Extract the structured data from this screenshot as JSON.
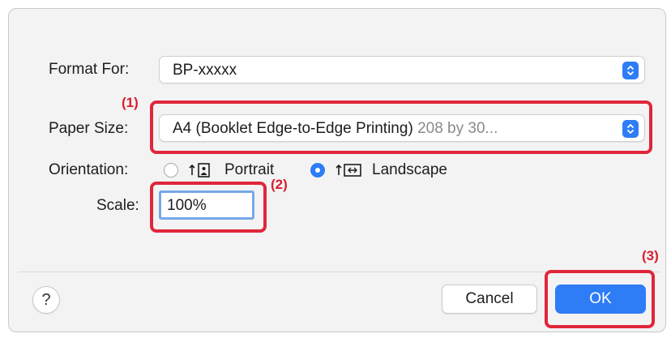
{
  "format_for": {
    "label": "Format For:",
    "value": "BP-xxxxx"
  },
  "paper_size": {
    "label": "Paper Size:",
    "value": "A4 (Booklet Edge-to-Edge Printing)",
    "detail": "208 by 30..."
  },
  "orientation": {
    "label": "Orientation:",
    "options": [
      {
        "label": "Portrait",
        "selected": false
      },
      {
        "label": "Landscape",
        "selected": true
      }
    ]
  },
  "scale": {
    "label": "Scale:",
    "value": "100%"
  },
  "callouts": {
    "one": "(1)",
    "two": "(2)",
    "three": "(3)"
  },
  "buttons": {
    "help": "?",
    "cancel": "Cancel",
    "ok": "OK"
  },
  "colors": {
    "accent": "#2e7cf6",
    "callout": "#e0263b"
  }
}
